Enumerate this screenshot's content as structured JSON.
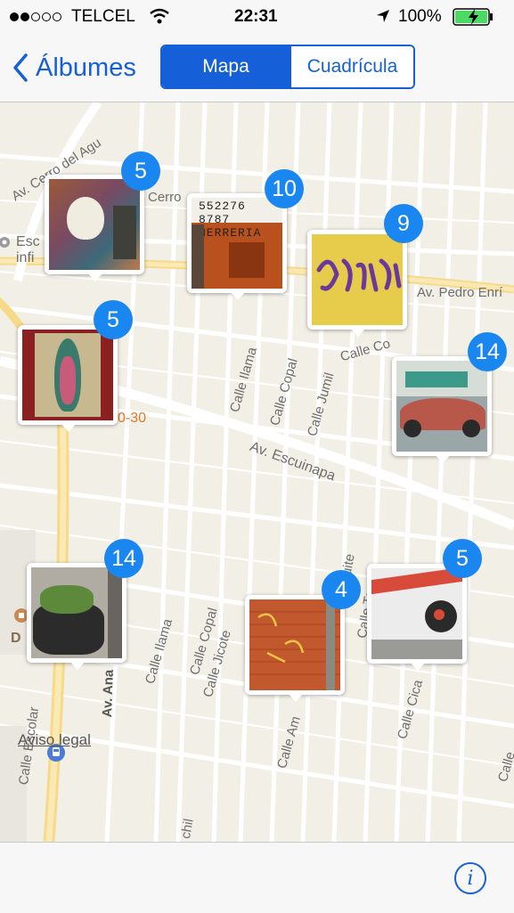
{
  "status": {
    "carrier": "TELCEL",
    "time": "22:31",
    "battery": "100%",
    "accent": "#1560d8"
  },
  "nav": {
    "back_label": "Álbumes",
    "segments": [
      "Mapa",
      "Cuadrícula"
    ],
    "selected": "Mapa"
  },
  "map": {
    "streets": [
      "Av. Cerro del Agu",
      "Cerro",
      "Av. Pedro Enrí",
      "Calle Co",
      "Av. Escuinapa",
      "Calle Ilama",
      "Calle Copal",
      "Calle Jumil",
      "Calle Ilama",
      "Calle Copal",
      "Calle Jicote",
      "Calle Am",
      "Calle Te",
      "Calle Cica",
      "Av. Ana",
      "Calle Escolar",
      "squite",
      "chil",
      "Esc",
      "infi",
      "D",
      "0-30",
      "Calle"
    ],
    "legal": "Aviso legal",
    "albums": [
      {
        "count": "5",
        "photo": "calla lily mural"
      },
      {
        "count": "10",
        "photo": "herreria storefront"
      },
      {
        "count": "9",
        "photo": "purple graffiti"
      },
      {
        "count": "5",
        "photo": "virgin of guadalupe tiles"
      },
      {
        "count": "14",
        "photo": "vw beetle"
      },
      {
        "count": "14",
        "photo": "tire planter"
      },
      {
        "count": "4",
        "photo": "brick wall graffiti"
      },
      {
        "count": "5",
        "photo": "zapata mural"
      }
    ]
  },
  "toolbar": {
    "info_icon": "i"
  }
}
